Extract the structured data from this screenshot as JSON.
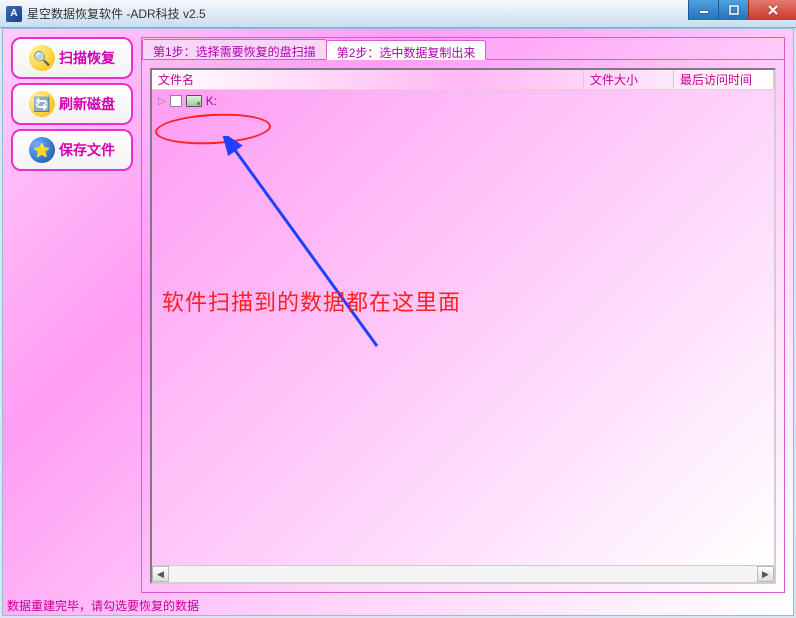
{
  "window": {
    "title": "星空数据恢复软件   -ADR科技 v2.5"
  },
  "sidebar": {
    "scan_label": "扫描恢复",
    "refresh_label": "刷新磁盘",
    "save_label": "保存文件"
  },
  "tabs": {
    "step1": "第1步：选择需要恢复的盘扫描",
    "step2": "第2步：选中数据复制出来"
  },
  "columns": {
    "name": "文件名",
    "size": "文件大小",
    "accessed": "最后访问时间"
  },
  "rows": [
    {
      "label": "K:"
    }
  ],
  "annotation": {
    "text": "软件扫描到的数据都在这里面"
  },
  "status": "数据重建完毕，请勾选要恢复的数据"
}
